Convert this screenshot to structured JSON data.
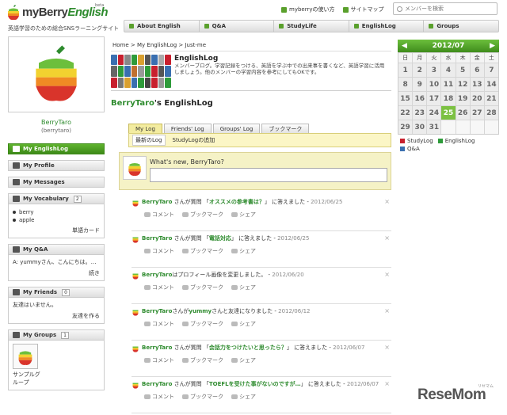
{
  "header": {
    "brand_my": "my",
    "brand_berry": "Berry",
    "brand_english": "English",
    "beta": "beta",
    "tagline": "英語学習のための総合SNSラーニングサイト",
    "top_links": [
      "myberryの使い方",
      "サイトマップ"
    ],
    "search_placeholder": "メンバーを検索",
    "nav": [
      "About English",
      "Q&A",
      "StudyLife",
      "EnglishLog",
      "Groups"
    ]
  },
  "profile": {
    "name": "BerryTaro",
    "id": "(berrytaro)"
  },
  "menu": {
    "englishlog": "My EnglishLog",
    "profile": "My Profile",
    "messages": "My Messages",
    "vocab": "My Vocabulary",
    "vocab_count": "2",
    "vocab_words": [
      "berry",
      "apple"
    ],
    "vocab_link": "単語カード",
    "qa": "My Q&A",
    "qa_text": "A: yummyさん、こんにちは。…",
    "qa_link": "続き",
    "friends": "My Friends",
    "friends_count": "0",
    "friends_text": "友達はいません。",
    "friends_link": "友達を作る",
    "groups": "My Groups",
    "groups_count": "1",
    "group_name": "サンプルグループ"
  },
  "main": {
    "breadcrumb": "Home  >  My EnglishLog  >  Just-me",
    "intro_title": "EnglishLog",
    "intro_text": "メンバーブログ。学習記録をつける、英語を学ぶ中での出来事を書くなど、英語学習に活用しましょう。他のメンバーの学習内容を参考にしてもOKです。",
    "title_name": "BerryTaro",
    "title_rest": "'s EnglishLog",
    "tabs": [
      "My Log",
      "Friends' Log",
      "Groups' Log",
      "ブックマーク"
    ],
    "subtabs": [
      "最新のLog",
      "StudyLogの追加"
    ],
    "prompt": "What's new, BerryTaro?"
  },
  "feed": [
    {
      "who": "BerryTaro",
      "pre": " さんが質問 「",
      "q": "オススメの参考書は？",
      "post": "」 に答えました -",
      "date": "2012/06/25"
    },
    {
      "who": "BerryTaro",
      "pre": " さんが質問 「",
      "q": "電話対応",
      "post": "」 に答えました -",
      "date": "2012/06/25"
    },
    {
      "who": "BerryTaro",
      "pre": "はプロフィール画像を変更しました。",
      "q": "",
      "post": " -",
      "date": "2012/06/20"
    },
    {
      "who": "BerryTaro",
      "pre": "さんが",
      "q": "yummy",
      "post": "さんと友達になりました -",
      "date": "2012/06/12"
    },
    {
      "who": "BerryTaro",
      "pre": " さんが質問 「",
      "q": "会話力をつけたいと思ったら？",
      "post": "」 に答えました -",
      "date": "2012/06/07"
    },
    {
      "who": "BerryTaro",
      "pre": " さんが質問 「",
      "q": "TOEFLを受けた事がないのですが…",
      "post": "」 に答えました -",
      "date": "2012/06/07"
    }
  ],
  "feed_actions": [
    "コメント",
    "ブックマーク",
    "シェア"
  ],
  "feed_close": "×",
  "calendar": {
    "prev": "◀",
    "month": "2012/07",
    "next": "▶",
    "dow": [
      "日",
      "月",
      "火",
      "水",
      "木",
      "金",
      "土"
    ],
    "days": [
      "1",
      "2",
      "3",
      "4",
      "5",
      "6",
      "7",
      "8",
      "9",
      "10",
      "11",
      "12",
      "13",
      "14",
      "15",
      "16",
      "17",
      "18",
      "19",
      "20",
      "21",
      "22",
      "23",
      "24",
      "25",
      "26",
      "27",
      "28",
      "29",
      "30",
      "31"
    ],
    "today": "25",
    "legend": [
      {
        "label": "StudyLog",
        "color": "#c8202e"
      },
      {
        "label": "EnglishLog",
        "color": "#2e9b3a"
      },
      {
        "label": "Q&A",
        "color": "#3a6fb0"
      }
    ]
  },
  "watermark": "ReseMom",
  "watermark_kana": "リセマム"
}
